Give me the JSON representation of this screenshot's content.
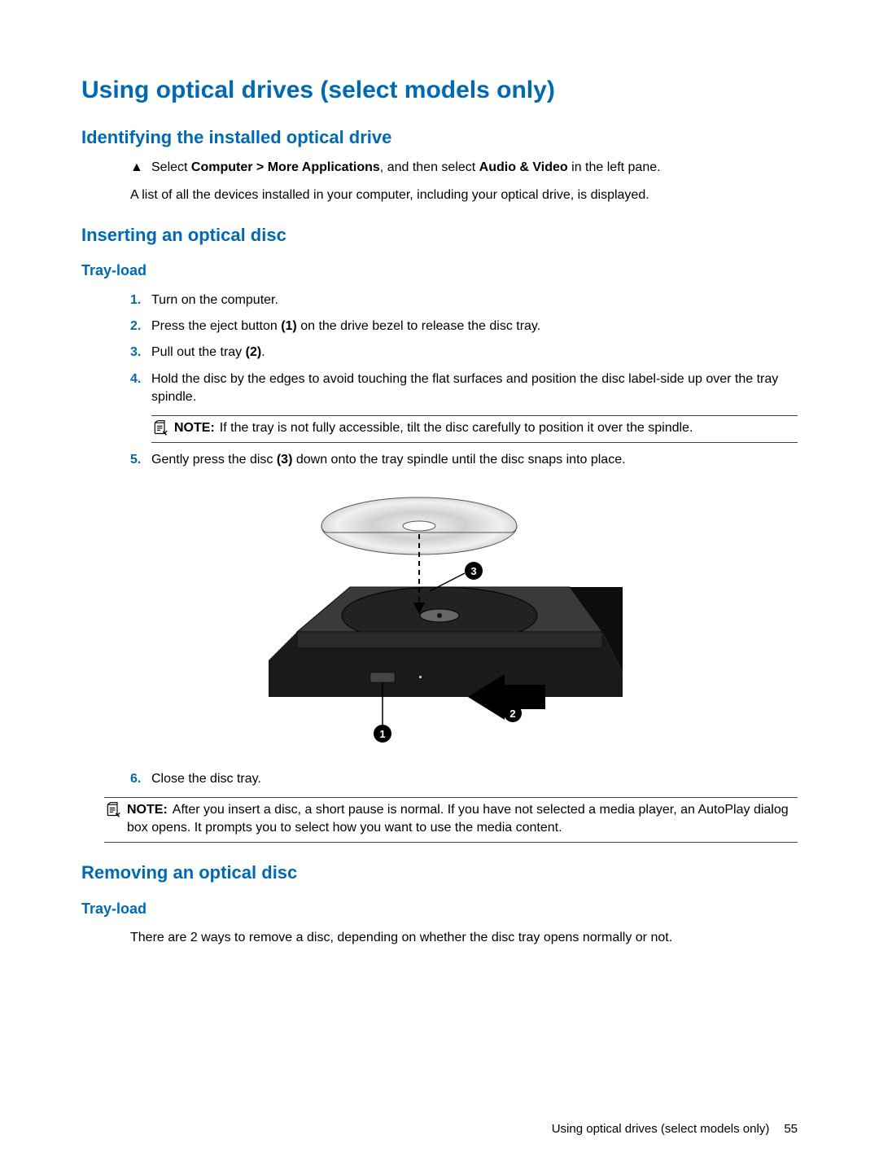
{
  "heading_main": "Using optical drives (select models only)",
  "section_identify": {
    "heading": "Identifying the installed optical drive",
    "step_marker": "▲",
    "step_prefix": "Select ",
    "step_bold1": "Computer > More Applications",
    "step_mid": ", and then select ",
    "step_bold2": "Audio & Video",
    "step_suffix": " in the left pane.",
    "result": "A list of all the devices installed in your computer, including your optical drive, is displayed."
  },
  "section_insert": {
    "heading": "Inserting an optical disc",
    "sub_heading": "Tray-load",
    "steps": [
      {
        "num": "1.",
        "pre": "Turn on the computer.",
        "b1": "",
        "mid": "",
        "b2": "",
        "suf": ""
      },
      {
        "num": "2.",
        "pre": "Press the eject button ",
        "b1": "(1)",
        "mid": " on the drive bezel to release the disc tray.",
        "b2": "",
        "suf": ""
      },
      {
        "num": "3.",
        "pre": "Pull out the tray ",
        "b1": "(2)",
        "mid": ".",
        "b2": "",
        "suf": ""
      },
      {
        "num": "4.",
        "pre": "Hold the disc by the edges to avoid touching the flat surfaces and position the disc label-side up over the tray spindle.",
        "b1": "",
        "mid": "",
        "b2": "",
        "suf": ""
      },
      {
        "num": "5.",
        "pre": "Gently press the disc ",
        "b1": "(3)",
        "mid": " down onto the tray spindle until the disc snaps into place.",
        "b2": "",
        "suf": ""
      },
      {
        "num": "6.",
        "pre": "Close the disc tray.",
        "b1": "",
        "mid": "",
        "b2": "",
        "suf": ""
      }
    ],
    "note1_label": "NOTE:",
    "note1_text": "If the tray is not fully accessible, tilt the disc carefully to position it over the spindle.",
    "note2_label": "NOTE:",
    "note2_text": "After you insert a disc, a short pause is normal. If you have not selected a media player, an AutoPlay dialog box opens. It prompts you to select how you want to use the media content."
  },
  "section_remove": {
    "heading": "Removing an optical disc",
    "sub_heading": "Tray-load",
    "intro": "There are 2 ways to remove a disc, depending on whether the disc tray opens normally or not."
  },
  "figure": {
    "callouts": [
      "1",
      "2",
      "3"
    ]
  },
  "footer": {
    "title": "Using optical drives (select models only)",
    "page_number": "55"
  }
}
